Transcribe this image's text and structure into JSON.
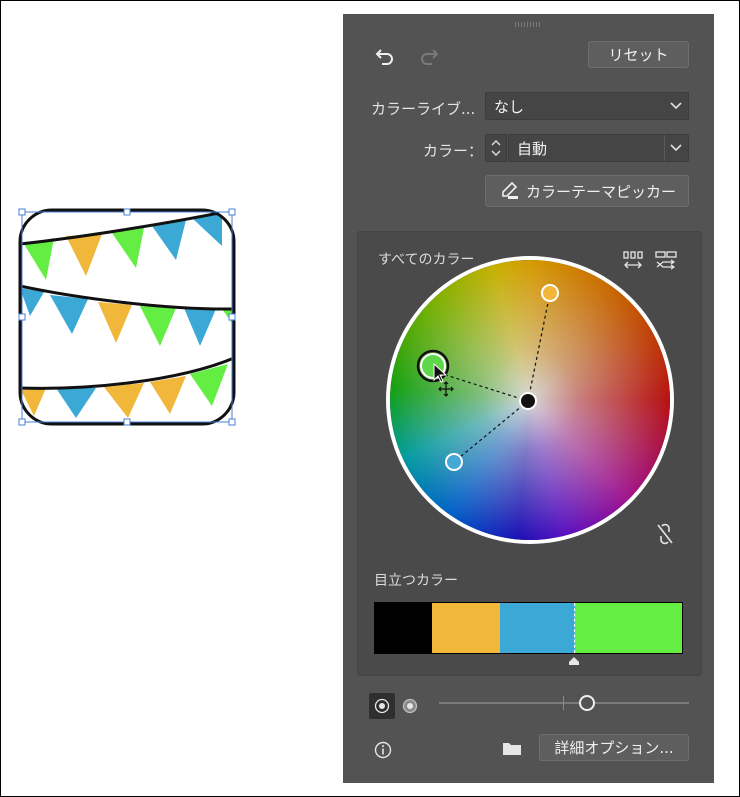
{
  "panel": {
    "reset_label": "リセット",
    "color_library": {
      "label": "カラーライブ...",
      "value": "なし"
    },
    "color": {
      "label": "カラー：",
      "value": "自動"
    },
    "theme_picker_label": "カラーテーマピッカー",
    "all_colors_label": "すべてのカラー",
    "prominent_colors_label": "目立つカラー",
    "advanced_options_label": "詳細オプション..."
  },
  "prominent_colors": [
    "#000000",
    "#f0b73a",
    "#3ba8d6",
    "#64ee44"
  ],
  "harmony_colors": [
    "#f0b73a",
    "#5ed84a",
    "#45a9d6"
  ],
  "icons": [
    "undo-icon",
    "redo-icon",
    "eyedropper-icon",
    "fill-gaps-icon",
    "shuffle-icon",
    "unlink-icon",
    "info-icon",
    "folder-icon"
  ]
}
